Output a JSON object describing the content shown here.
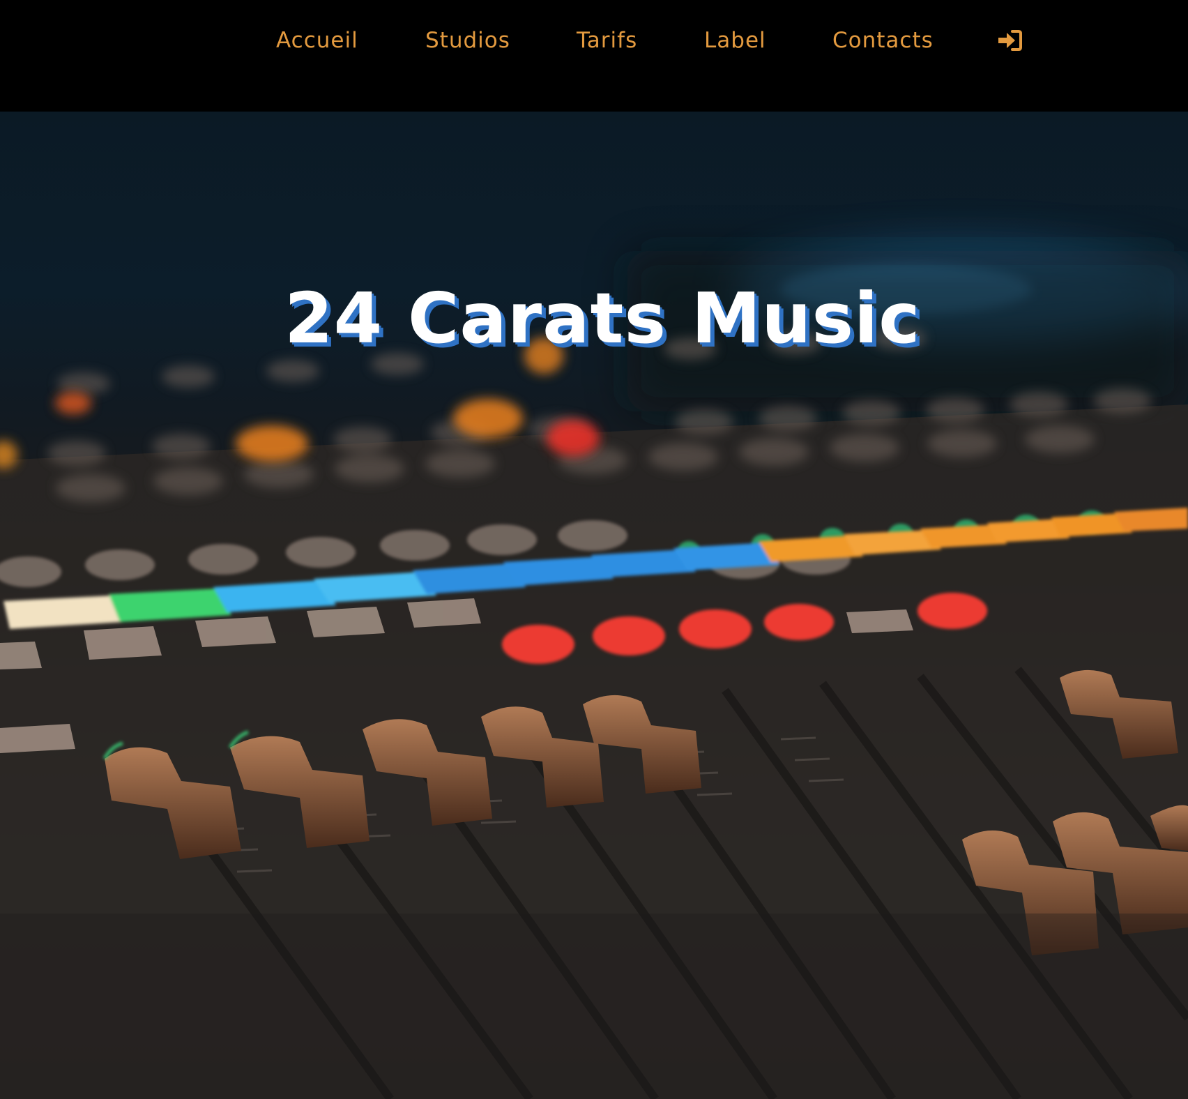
{
  "nav": {
    "items": [
      {
        "label": "Accueil"
      },
      {
        "label": "Studios"
      },
      {
        "label": "Tarifs"
      },
      {
        "label": "Label"
      },
      {
        "label": "Contacts"
      }
    ],
    "login_icon": "sign-in-icon"
  },
  "hero": {
    "title": "24 Carats Music",
    "background": "mixing-console-photo"
  },
  "colors": {
    "nav_text": "#e39a3f",
    "nav_background": "#000000",
    "title_text": "#ffffff",
    "title_shadow": "#2f72c4"
  }
}
